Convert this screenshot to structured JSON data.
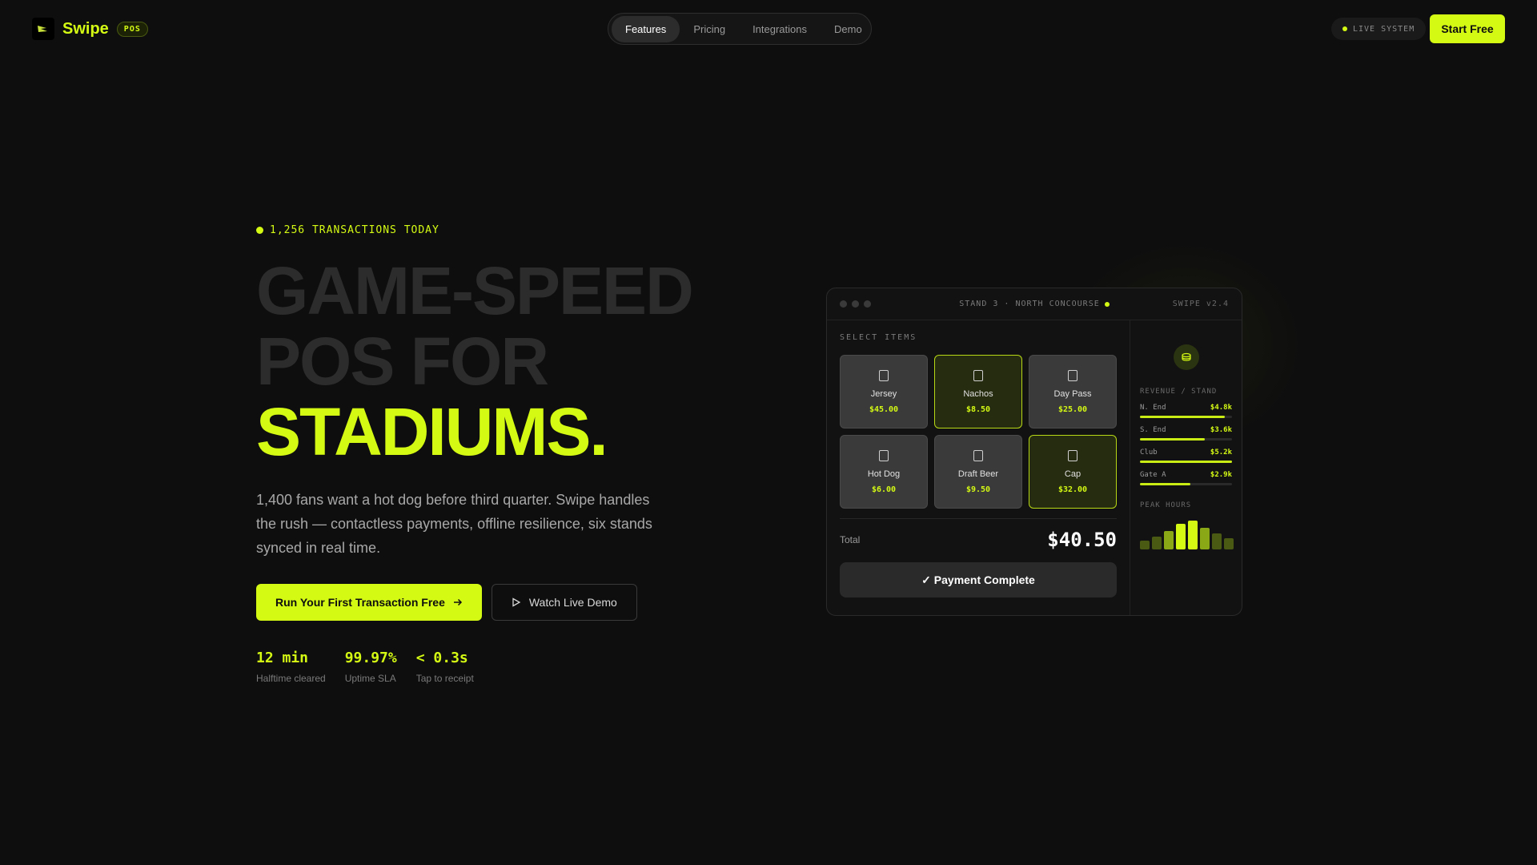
{
  "nav": {
    "brand": "Swipe",
    "badge": "POS",
    "links": [
      "Features",
      "Pricing",
      "Integrations",
      "Demo"
    ],
    "active_link": "Features",
    "live_label": "LIVE SYSTEM",
    "cta": "Start Free"
  },
  "hero": {
    "transactions": "1,256 TRANSACTIONS TODAY",
    "headline_line1": "GAME-SPEED",
    "headline_line2": "POS FOR",
    "headline_line3": "STADIUMS.",
    "lead": "1,400 fans want a hot dog before third quarter. Swipe handles the rush — contactless payments, offline resilience, six stands synced in real time.",
    "cta_primary": "Run Your First Transaction Free",
    "cta_secondary": "Watch Live Demo",
    "stats": [
      {
        "value": "12 min",
        "label": "Halftime cleared"
      },
      {
        "value": "99.97%",
        "label": "Uptime SLA"
      },
      {
        "value": "< 0.3s",
        "label": "Tap to receipt"
      }
    ]
  },
  "device": {
    "stand_title": "STAND 3 · NORTH CONCOURSE",
    "version": "SWIPE v2.4",
    "select_title": "SELECT ITEMS",
    "items": [
      {
        "name": "Jersey",
        "price": "$45.00",
        "selected": false
      },
      {
        "name": "Nachos",
        "price": "$8.50",
        "selected": true
      },
      {
        "name": "Day Pass",
        "price": "$25.00",
        "selected": false
      },
      {
        "name": "Hot Dog",
        "price": "$6.00",
        "selected": false
      },
      {
        "name": "Draft Beer",
        "price": "$9.50",
        "selected": false
      },
      {
        "name": "Cap",
        "price": "$32.00",
        "selected": true
      }
    ],
    "total_label": "Total",
    "total_value": "$40.50",
    "pay_label": "✓ Payment Complete",
    "revenue_title": "REVENUE / STAND",
    "revenue": [
      {
        "name": "N. End",
        "value": "$4.8k",
        "fill": 0.92
      },
      {
        "name": "S. End",
        "value": "$3.6k",
        "fill": 0.7
      },
      {
        "name": "Club",
        "value": "$5.2k",
        "fill": 1.0
      },
      {
        "name": "Gate A",
        "value": "$2.9k",
        "fill": 0.55
      }
    ],
    "peak_title": "PEAK HOURS",
    "peak_levels": [
      0.3,
      0.45,
      0.65,
      0.9,
      1.0,
      0.75,
      0.55,
      0.4
    ]
  },
  "colors": {
    "accent": "#d4fa14",
    "background": "#0e0e0e"
  }
}
